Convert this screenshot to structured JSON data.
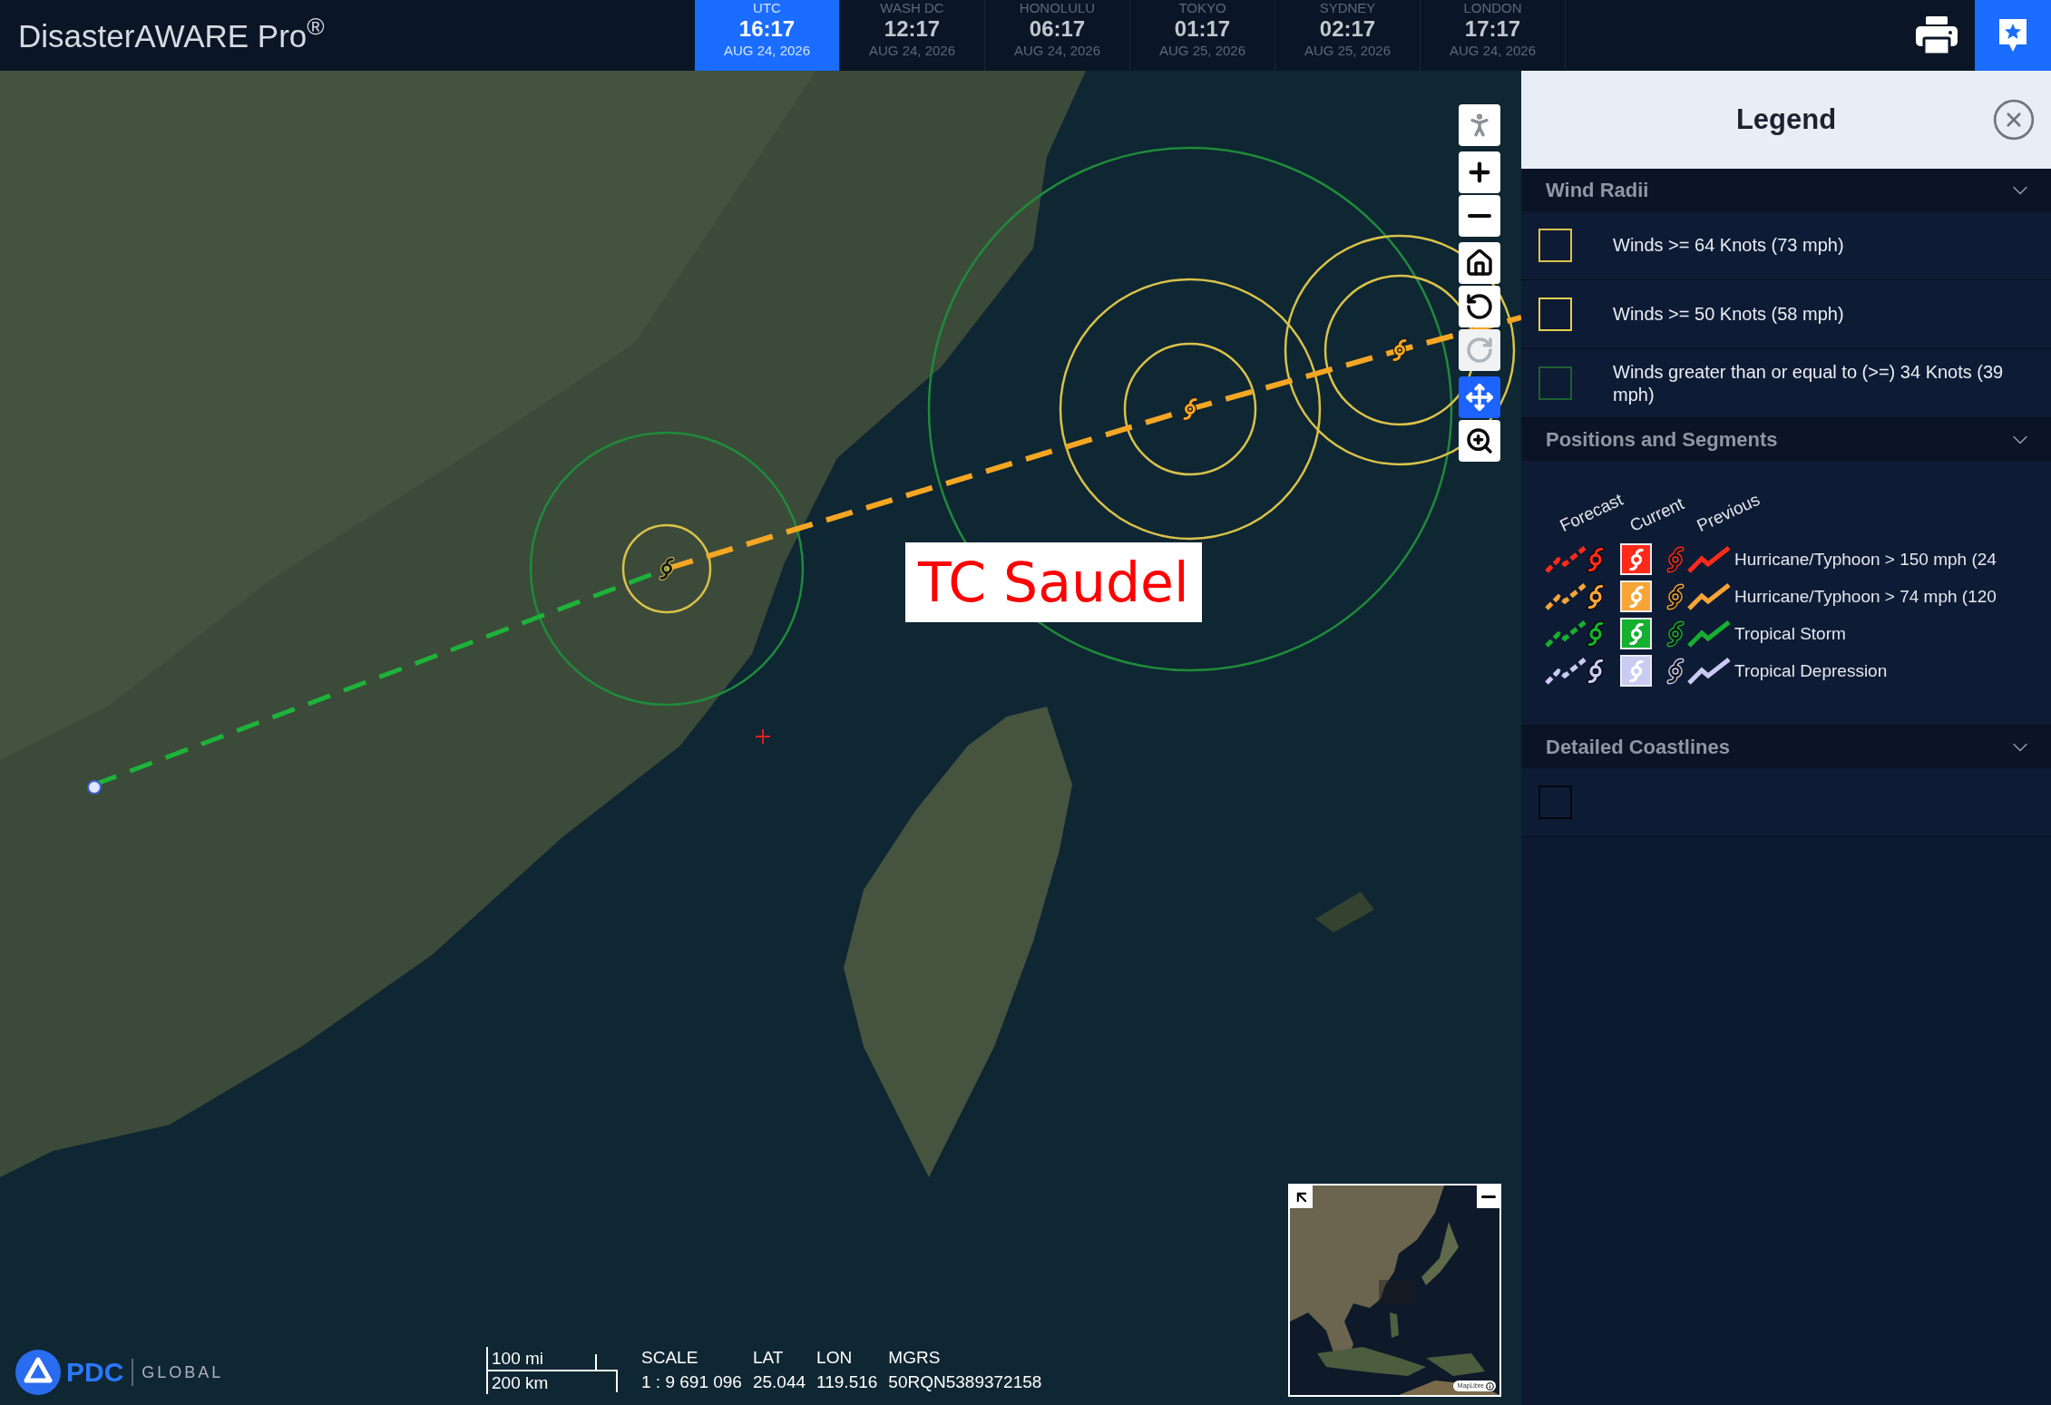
{
  "header": {
    "title": "DisasterAWARE Pro$^{®}$",
    "clocks": [
      {
        "label": "UTC",
        "time": "16:17",
        "date": "AUG 24, 2026",
        "selected": true
      },
      {
        "label": "WASH DC",
        "time": "12:17",
        "date": "AUG 24, 2026",
        "selected": false
      },
      {
        "label": "HONOLULU",
        "time": "06:17",
        "date": "AUG 24, 2026",
        "selected": false
      },
      {
        "label": "TOKYO",
        "time": "01:17",
        "date": "AUG 25, 2026",
        "selected": false
      },
      {
        "label": "SYDNEY",
        "time": "02:17",
        "date": "AUG 25, 2026",
        "selected": false
      },
      {
        "label": "LONDON",
        "time": "17:17",
        "date": "AUG 24, 2026",
        "selected": false
      }
    ],
    "toolbar": [
      {
        "kind": "print",
        "selected": false
      },
      {
        "kind": "legend",
        "selected": true
      }
    ]
  },
  "map": {
    "storm_label": "TC Saudel",
    "tools": [
      {
        "items": [
          {
            "kind": "pegman",
            "selected": false,
            "disabled": false
          }
        ]
      },
      {
        "items": [
          {
            "kind": "zoom_in",
            "selected": false,
            "disabled": false
          },
          {
            "kind": "zoom_out",
            "selected": false,
            "disabled": false
          }
        ]
      },
      {
        "items": [
          {
            "kind": "home",
            "selected": false,
            "disabled": false
          },
          {
            "kind": "rotate_left",
            "selected": false,
            "disabled": false
          },
          {
            "kind": "rotate_right",
            "selected": false,
            "disabled": true
          }
        ]
      },
      {
        "items": [
          {
            "kind": "pan",
            "selected": true,
            "disabled": false
          },
          {
            "kind": "zoom_box",
            "selected": false,
            "disabled": false
          }
        ]
      }
    ],
    "overview_map": {
      "attribution": "MapLibre"
    },
    "logo": {
      "name": "PDC",
      "tagline": "GLOBAL"
    },
    "scale_bar": {
      "imperial": "100 mi",
      "metric": "200 km"
    },
    "readouts": [
      {
        "label": "SCALE",
        "value": "1 : 9 691 096"
      },
      {
        "label": "LAT",
        "value": "25.044"
      },
      {
        "label": "LON",
        "value": "119.516"
      },
      {
        "label": "MGRS",
        "value": "50RQN5389372158"
      }
    ]
  },
  "legend": {
    "title": "Legend",
    "sections": [
      {
        "kind": "swatches",
        "title": "Wind Radii",
        "expanded": true,
        "items": [
          {
            "label": "Winds >= 64 Knots (73 mph)",
            "color": "#d9c24c"
          },
          {
            "label": "Winds >= 50 Knots (58 mph)",
            "color": "#e3cf4b"
          },
          {
            "label": "Winds greater than or equal to (>=) 34 Knots (39 mph)",
            "color": "#1e5f30"
          }
        ]
      },
      {
        "kind": "positions",
        "title": "Positions and Segments",
        "expanded": true,
        "columns": [
          "Forecast",
          "Current",
          "Previous"
        ],
        "items": [
          {
            "label": "Hurricane/Typhoon > 150 mph (24",
            "color": "#ff2a1a"
          },
          {
            "label": "Hurricane/Typhoon > 74 mph (120",
            "color": "#f7a536"
          },
          {
            "label": "Tropical Storm",
            "color": "#15b02f"
          },
          {
            "label": "Tropical Depression",
            "color": "#c9cbf2"
          }
        ]
      },
      {
        "kind": "swatches",
        "title": "Detailed Coastlines",
        "expanded": true,
        "items": [
          {
            "color": "#03070e"
          }
        ]
      }
    ]
  }
}
